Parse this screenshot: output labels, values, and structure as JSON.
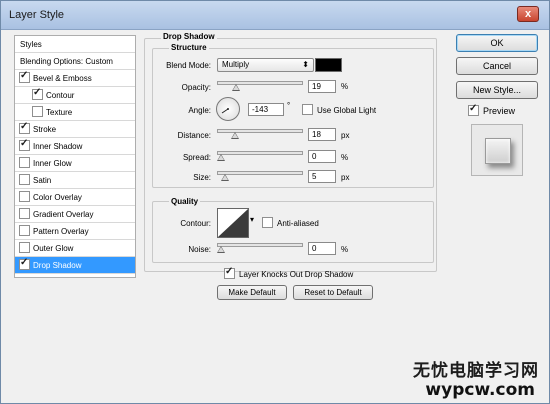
{
  "window": {
    "title": "Layer Style",
    "close_glyph": "x"
  },
  "style_list": {
    "header": "Styles",
    "items": [
      {
        "label": "Blending Options: Custom",
        "checkbox": false,
        "checked": false,
        "indent": 0
      },
      {
        "label": "Bevel & Emboss",
        "checkbox": true,
        "checked": true,
        "indent": 0
      },
      {
        "label": "Contour",
        "checkbox": true,
        "checked": true,
        "indent": 1
      },
      {
        "label": "Texture",
        "checkbox": true,
        "checked": false,
        "indent": 1
      },
      {
        "label": "Stroke",
        "checkbox": true,
        "checked": true,
        "indent": 0
      },
      {
        "label": "Inner Shadow",
        "checkbox": true,
        "checked": true,
        "indent": 0
      },
      {
        "label": "Inner Glow",
        "checkbox": true,
        "checked": false,
        "indent": 0
      },
      {
        "label": "Satin",
        "checkbox": true,
        "checked": false,
        "indent": 0
      },
      {
        "label": "Color Overlay",
        "checkbox": true,
        "checked": false,
        "indent": 0
      },
      {
        "label": "Gradient Overlay",
        "checkbox": true,
        "checked": false,
        "indent": 0
      },
      {
        "label": "Pattern Overlay",
        "checkbox": true,
        "checked": false,
        "indent": 0
      },
      {
        "label": "Outer Glow",
        "checkbox": true,
        "checked": false,
        "indent": 0
      },
      {
        "label": "Drop Shadow",
        "checkbox": true,
        "checked": true,
        "indent": 0,
        "selected": true
      }
    ]
  },
  "drop_shadow": {
    "section_title": "Drop Shadow",
    "structure": {
      "title": "Structure",
      "blend_mode_label": "Blend Mode:",
      "blend_mode_value": "Multiply",
      "shadow_color": "#000000",
      "opacity_label": "Opacity:",
      "opacity_value": "19",
      "opacity_unit": "%",
      "angle_label": "Angle:",
      "angle_value": "-143",
      "angle_unit": "°",
      "use_global_light_label": "Use Global Light",
      "use_global_light_checked": false,
      "distance_label": "Distance:",
      "distance_value": "18",
      "distance_unit": "px",
      "spread_label": "Spread:",
      "spread_value": "0",
      "spread_unit": "%",
      "size_label": "Size:",
      "size_value": "5",
      "size_unit": "px"
    },
    "quality": {
      "title": "Quality",
      "contour_label": "Contour:",
      "anti_aliased_label": "Anti-aliased",
      "anti_aliased_checked": false,
      "noise_label": "Noise:",
      "noise_value": "0",
      "noise_unit": "%"
    },
    "knockout_label": "Layer Knocks Out Drop Shadow",
    "knockout_checked": true,
    "make_default_label": "Make Default",
    "reset_default_label": "Reset to Default"
  },
  "sliders": {
    "opacity_fraction": 0.19,
    "distance_fraction": 0.18,
    "spread_fraction": 0.0,
    "size_fraction": 0.05,
    "noise_fraction": 0.0
  },
  "buttons": {
    "ok": "OK",
    "cancel": "Cancel",
    "new_style": "New Style...",
    "preview_label": "Preview",
    "preview_checked": true
  },
  "watermark": {
    "line1": "无忧电脑学习网",
    "line2": "wypcw.com"
  }
}
